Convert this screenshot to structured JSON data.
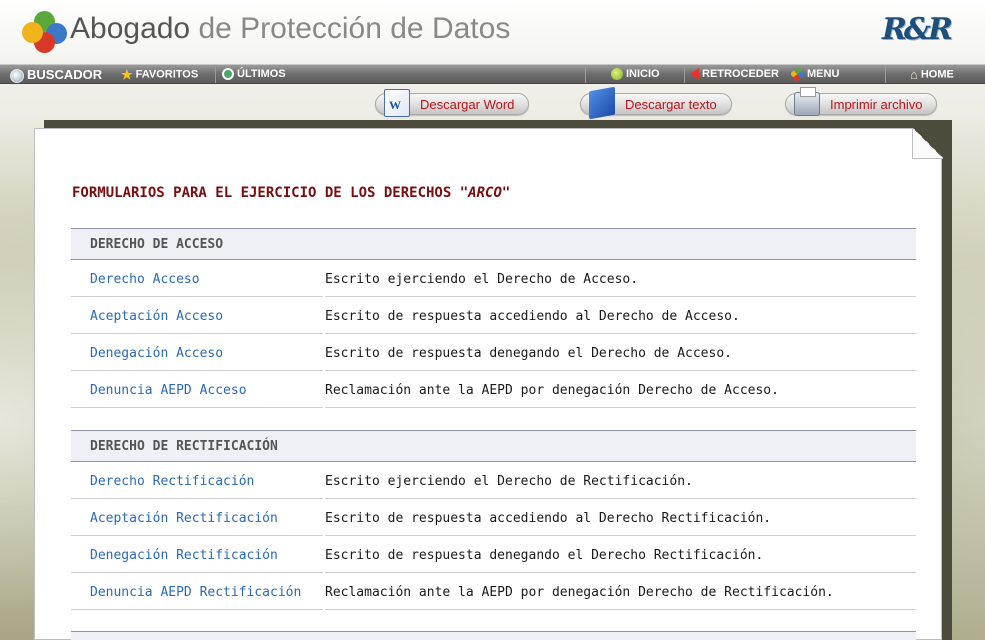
{
  "header": {
    "title_part1": "Abogado",
    "title_part2": "de Protección de Datos",
    "brand_logo_text": "R&R"
  },
  "navbar": {
    "search": "BUSCADOR",
    "favorites": "FAVORITOS",
    "recent": "ÚLTIMOS",
    "start": "INICIO",
    "back": "RETROCEDER",
    "menu": "MENU",
    "home": "HOME"
  },
  "downloads": {
    "word": "Descargar Word",
    "text": "Descargar texto",
    "print": "Imprimir archivo"
  },
  "content": {
    "title": "FORMULARIOS PARA EL EJERCICIO DE LOS DERECHOS",
    "title_em": "\"ARCO\"",
    "sections": [
      {
        "heading": "DERECHO DE ACCESO",
        "rows": [
          {
            "link": "Derecho Acceso",
            "desc": "Escrito ejerciendo el Derecho de Acceso."
          },
          {
            "link": "Aceptación Acceso",
            "desc": "Escrito de respuesta accediendo al Derecho de Acceso."
          },
          {
            "link": "Denegación Acceso",
            "desc": "Escrito de respuesta denegando el Derecho de Acceso."
          },
          {
            "link": "Denuncia AEPD Acceso",
            "desc": "Reclamación ante la AEPD por denegación Derecho de Acceso."
          }
        ]
      },
      {
        "heading": "DERECHO DE RECTIFICACIÓN",
        "rows": [
          {
            "link": "Derecho Rectificación",
            "desc": "Escrito ejerciendo el Derecho de Rectificación."
          },
          {
            "link": "Aceptación Rectificación",
            "desc": "Escrito de respuesta accediendo al Derecho Rectificación."
          },
          {
            "link": "Denegación Rectificación",
            "desc": "Escrito de respuesta denegando el Derecho Rectificación."
          },
          {
            "link": "Denuncia AEPD Rectificación",
            "desc": "Reclamación ante la AEPD por denegación Derecho de Rectificación."
          }
        ]
      }
    ]
  },
  "colors": {
    "title": "#7a0d0d",
    "link": "#2a6ab8",
    "download_text": "#c0141a",
    "navbar": "#6e6e6e"
  }
}
